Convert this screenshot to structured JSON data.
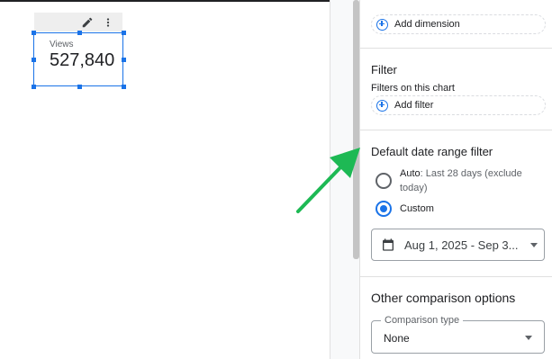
{
  "scorecard": {
    "label": "Views",
    "value": "527,840"
  },
  "widget_toolbar": {
    "icons": [
      "pencil-icon",
      "more-vert-icon"
    ]
  },
  "panel": {
    "sparkline": {
      "add_dimension_label": "Add dimension"
    },
    "filter": {
      "title": "Filter",
      "subtitle": "Filters on this chart",
      "add_filter_label": "Add filter"
    },
    "date_range": {
      "title": "Default date range filter",
      "auto_label": "Auto",
      "auto_detail_line1": ": Last 28 days (exclude",
      "auto_detail_line2": "today)",
      "custom_label": "Custom",
      "selected": "Custom",
      "date_value": "Aug 1, 2025 - Sep 3..."
    },
    "comparison": {
      "title": "Other comparison options",
      "type_label": "Comparison type",
      "type_value": "None"
    }
  },
  "colors": {
    "accent": "#1a73e8",
    "arrow": "#1db954"
  }
}
